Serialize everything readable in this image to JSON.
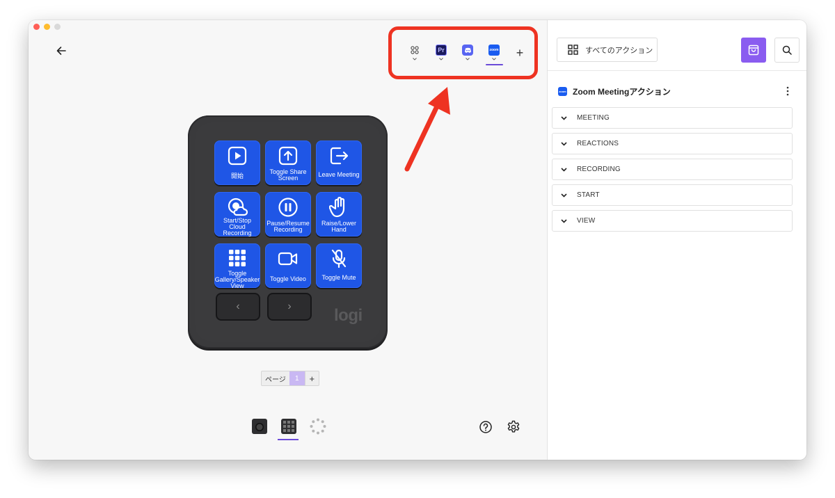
{
  "window": {
    "traffic_colors": [
      "#ff5f57",
      "#febc2e",
      "#d9d9d9"
    ]
  },
  "profiles": [
    {
      "name": "all-profile",
      "icon": "grid-4-dots-icon",
      "active": false
    },
    {
      "name": "premiere-pro",
      "icon": "premiere-pro-icon",
      "text": "Pr",
      "color": "#1a1a5c",
      "active": false
    },
    {
      "name": "discord",
      "icon": "discord-icon",
      "color": "#5865f2",
      "active": false
    },
    {
      "name": "zoom",
      "icon": "zoom-icon",
      "text": "zoom",
      "color": "#1a5cf0",
      "active": true
    }
  ],
  "add_profile": "+",
  "keys": [
    {
      "icon": "play-icon",
      "label": "開始"
    },
    {
      "icon": "share-screen-icon",
      "label": "Toggle Share Screen"
    },
    {
      "icon": "leave-icon",
      "label": "Leave Meeting"
    },
    {
      "icon": "cloud-record-icon",
      "label": "Start/Stop Cloud Recording"
    },
    {
      "icon": "pause-icon",
      "label": "Pause/Resume Recording"
    },
    {
      "icon": "hand-icon",
      "label": "Raise/Lower Hand"
    },
    {
      "icon": "gallery-icon",
      "label": "Toggle Gallery/Speaker View"
    },
    {
      "icon": "video-icon",
      "label": "Toggle Video"
    },
    {
      "icon": "mic-mute-icon",
      "label": "Toggle Mute"
    }
  ],
  "nav": {
    "prev": "‹",
    "next": "›"
  },
  "brand": "logi",
  "pager": {
    "label": "ページ",
    "current": "1",
    "add": "+"
  },
  "device_tabs": [
    "dial-device",
    "keypad-device",
    "ring-device"
  ],
  "panel": {
    "all_actions_label": "すべてのアクション",
    "app_title": "Zoom Meetingアクション",
    "sections": [
      "MEETING",
      "REACTIONS",
      "RECORDING",
      "START",
      "VIEW"
    ],
    "shop_color": "#8a5cf0"
  },
  "annotation_color": "#ee3322"
}
